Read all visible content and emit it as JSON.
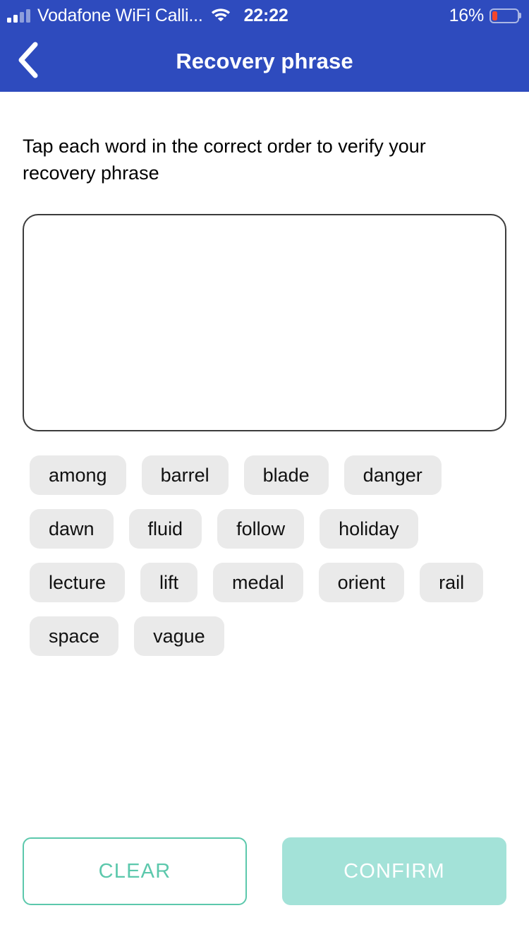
{
  "status_bar": {
    "signal_icon": "signal-bars-icon",
    "carrier": "Vodafone WiFi Calli...",
    "wifi_icon": "wifi-icon",
    "time": "22:22",
    "battery_percent": "16%",
    "battery_level": 16,
    "battery_icon": "battery-low-icon"
  },
  "nav": {
    "back_icon": "chevron-left-icon",
    "title": "Recovery phrase"
  },
  "main": {
    "instruction": "Tap each word in the correct order to verify your recovery phrase",
    "selected_phrase": "",
    "word_bank": [
      "among",
      "barrel",
      "blade",
      "danger",
      "dawn",
      "fluid",
      "follow",
      "holiday",
      "lecture",
      "lift",
      "medal",
      "orient",
      "rail",
      "space",
      "vague"
    ]
  },
  "footer": {
    "clear_label": "CLEAR",
    "confirm_label": "CONFIRM"
  },
  "colors": {
    "header_blue": "#2E4BBE",
    "chip_gray": "#EAEAEA",
    "accent_teal": "#5CC8AC",
    "confirm_disabled": "#A3E2D8",
    "battery_red": "#F4462A",
    "box_border": "#3C3C3C"
  }
}
